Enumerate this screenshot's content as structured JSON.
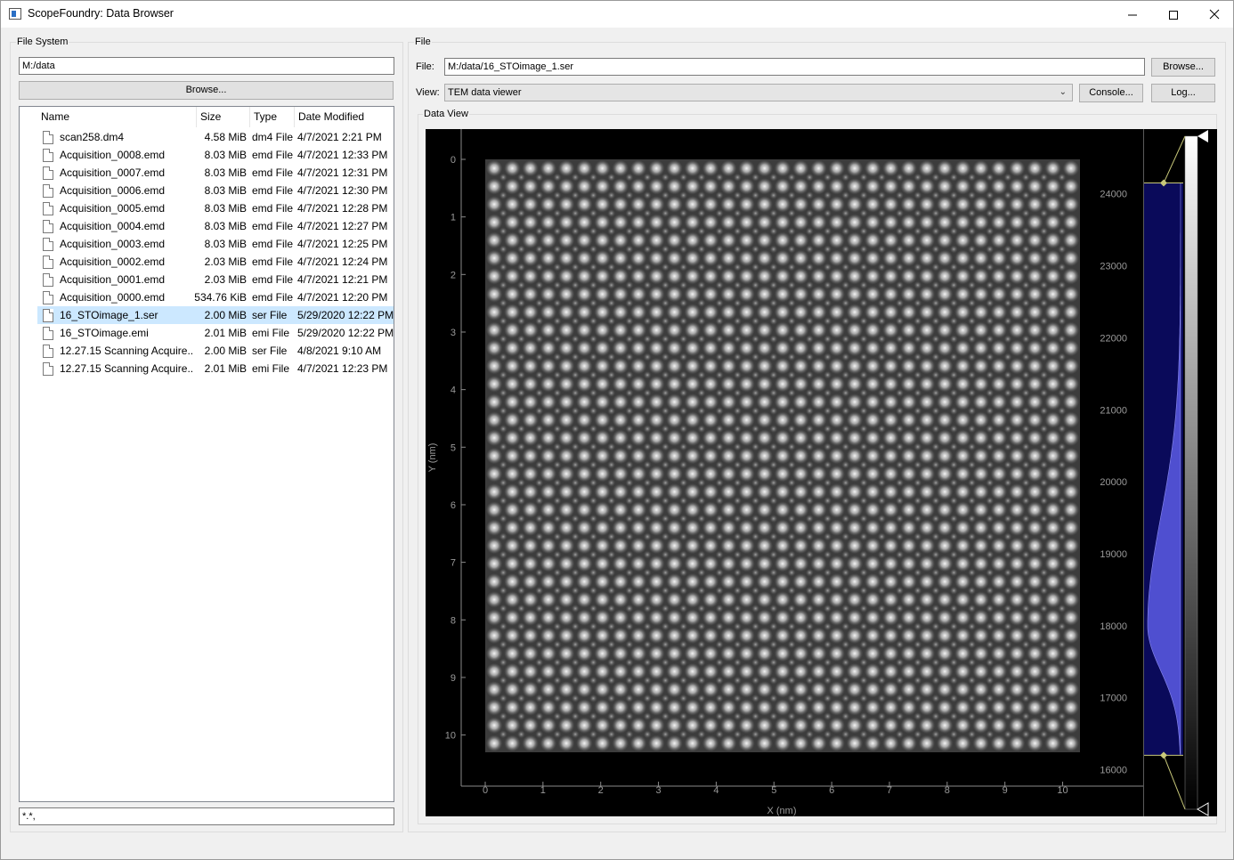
{
  "window": {
    "title": "ScopeFoundry: Data Browser",
    "min_icon": "minimize-icon",
    "max_icon": "maximize-icon",
    "close_icon": "close-icon"
  },
  "file_system": {
    "group_title": "File System",
    "path": "M:/data",
    "browse_label": "Browse...",
    "columns": [
      "Name",
      "Size",
      "Type",
      "Date Modified"
    ],
    "files": [
      {
        "name": "scan258.dm4",
        "size": "4.58 MiB",
        "type": "dm4 File",
        "date": "4/7/2021 2:21 PM"
      },
      {
        "name": "Acquisition_0008.emd",
        "size": "8.03 MiB",
        "type": "emd File",
        "date": "4/7/2021 12:33 PM"
      },
      {
        "name": "Acquisition_0007.emd",
        "size": "8.03 MiB",
        "type": "emd File",
        "date": "4/7/2021 12:31 PM"
      },
      {
        "name": "Acquisition_0006.emd",
        "size": "8.03 MiB",
        "type": "emd File",
        "date": "4/7/2021 12:30 PM"
      },
      {
        "name": "Acquisition_0005.emd",
        "size": "8.03 MiB",
        "type": "emd File",
        "date": "4/7/2021 12:28 PM"
      },
      {
        "name": "Acquisition_0004.emd",
        "size": "8.03 MiB",
        "type": "emd File",
        "date": "4/7/2021 12:27 PM"
      },
      {
        "name": "Acquisition_0003.emd",
        "size": "8.03 MiB",
        "type": "emd File",
        "date": "4/7/2021 12:25 PM"
      },
      {
        "name": "Acquisition_0002.emd",
        "size": "2.03 MiB",
        "type": "emd File",
        "date": "4/7/2021 12:24 PM"
      },
      {
        "name": "Acquisition_0001.emd",
        "size": "2.03 MiB",
        "type": "emd File",
        "date": "4/7/2021 12:21 PM"
      },
      {
        "name": "Acquisition_0000.emd",
        "size": "534.76 KiB",
        "type": "emd File",
        "date": "4/7/2021 12:20 PM"
      },
      {
        "name": "16_STOimage_1.ser",
        "size": "2.00 MiB",
        "type": "ser File",
        "date": "5/29/2020 12:22 PM",
        "selected": true
      },
      {
        "name": "16_STOimage.emi",
        "size": "2.01 MiB",
        "type": "emi File",
        "date": "5/29/2020 12:22 PM"
      },
      {
        "name": "12.27.15 Scanning Acquire....",
        "size": "2.00 MiB",
        "type": "ser File",
        "date": "4/8/2021 9:10 AM"
      },
      {
        "name": "12.27.15 Scanning Acquire....",
        "size": "2.01 MiB",
        "type": "emi File",
        "date": "4/7/2021 12:23 PM"
      }
    ],
    "filter": "*.*,"
  },
  "file_panel": {
    "group_title": "File",
    "file_label": "File:",
    "file_path": "M:/data/16_STOimage_1.ser",
    "browse_label": "Browse...",
    "view_label": "View:",
    "view_value": "TEM data viewer",
    "console_label": "Console...",
    "log_label": "Log...",
    "data_view_title": "Data View"
  },
  "image_plot": {
    "xlabel": "X (nm)",
    "ylabel": "Y (nm)",
    "x_ticks": [
      "0",
      "1",
      "2",
      "3",
      "4",
      "5",
      "6",
      "7",
      "8",
      "9",
      "10"
    ],
    "y_ticks": [
      "0",
      "1",
      "2",
      "3",
      "4",
      "5",
      "6",
      "7",
      "8",
      "9",
      "10"
    ],
    "x_range": [
      0,
      10.3
    ],
    "y_range": [
      0,
      10.3
    ],
    "lattice_columns": 33,
    "lattice_rows": 33
  },
  "histogram": {
    "ticks": [
      "24000",
      "23000",
      "22000",
      "21000",
      "20000",
      "19000",
      "18000",
      "17000",
      "16000"
    ],
    "tick_values": [
      24000,
      23000,
      22000,
      21000,
      20000,
      19000,
      18000,
      17000,
      16000
    ],
    "range": [
      15450,
      24800
    ],
    "level_low": 16200,
    "level_high": 24150,
    "peak": 18000,
    "fill_color": "#4f4fd0",
    "region_color": "#0a0a5a",
    "line_color": "#c8c87a"
  }
}
